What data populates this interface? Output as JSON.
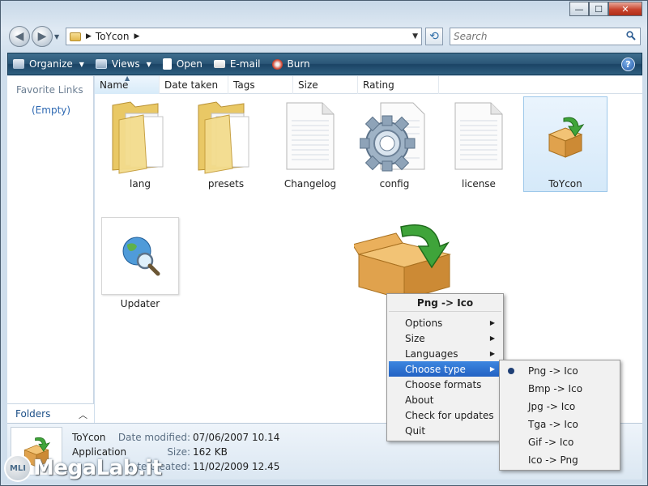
{
  "window": {
    "title": "ToYcon"
  },
  "caption": {
    "minimize": "—",
    "maximize": "☐",
    "close": "✕"
  },
  "address": {
    "breadcrumb": [
      "ToYcon"
    ]
  },
  "search": {
    "placeholder": "Search"
  },
  "toolbar": {
    "items": [
      {
        "label": "Organize",
        "icon": "organize-icon",
        "dropdown": true
      },
      {
        "label": "Views",
        "icon": "views-icon",
        "dropdown": true
      },
      {
        "label": "Open",
        "icon": "open-icon",
        "dropdown": false
      },
      {
        "label": "E-mail",
        "icon": "email-icon",
        "dropdown": false
      },
      {
        "label": "Burn",
        "icon": "burn-icon",
        "dropdown": false
      }
    ],
    "help": "?"
  },
  "left_pane": {
    "favorite_links": "Favorite Links",
    "empty": "(Empty)",
    "folders": "Folders"
  },
  "columns": [
    "Name",
    "Date taken",
    "Tags",
    "Size",
    "Rating"
  ],
  "items": [
    {
      "label": "lang",
      "icon": "folder-icon"
    },
    {
      "label": "presets",
      "icon": "folder-icon"
    },
    {
      "label": "Changelog",
      "icon": "text-file-icon"
    },
    {
      "label": "config",
      "icon": "gear-file-icon"
    },
    {
      "label": "license",
      "icon": "text-file-icon"
    },
    {
      "label": "ToYcon",
      "icon": "box-arrow-icon",
      "selected": true
    },
    {
      "label": "Updater",
      "icon": "globe-magnifier-icon"
    }
  ],
  "details": {
    "name": "ToYcon",
    "type": "Application",
    "date_modified_label": "Date modified:",
    "date_modified": "07/06/2007 10.14",
    "size_label": "Size:",
    "size": "162 KB",
    "date_created_label": "Date created:",
    "date_created": "11/02/2009 12.45"
  },
  "context_menu": {
    "title": "Png -> Ico",
    "items": [
      {
        "label": "Options",
        "submenu": true
      },
      {
        "label": "Size",
        "submenu": true
      },
      {
        "label": "Languages",
        "submenu": true
      },
      {
        "label": "Choose type",
        "submenu": true,
        "highlighted": true
      },
      {
        "label": "Choose formats",
        "submenu": false
      },
      {
        "label": "About",
        "submenu": false
      },
      {
        "label": "Check for updates",
        "submenu": false
      },
      {
        "label": "Quit",
        "submenu": false
      }
    ]
  },
  "type_submenu": {
    "items": [
      {
        "label": "Png -> Ico",
        "checked": true
      },
      {
        "label": "Bmp -> Ico",
        "checked": false
      },
      {
        "label": "Jpg -> Ico",
        "checked": false
      },
      {
        "label": "Tga -> Ico",
        "checked": false
      },
      {
        "label": "Gif -> Ico",
        "checked": false
      },
      {
        "label": "Ico -> Png",
        "checked": false
      }
    ]
  },
  "watermark": {
    "badge": "MLI",
    "text": "MegaLab.it"
  },
  "colors": {
    "toolbar": "#2b5677",
    "highlight": "#2f72d4",
    "link": "#2d68b2"
  }
}
